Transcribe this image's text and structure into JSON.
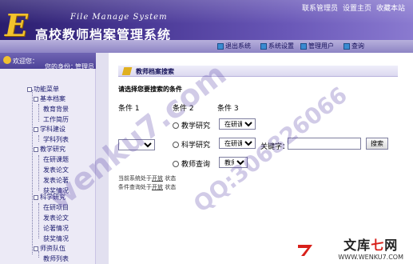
{
  "header": {
    "logo_letter": "E",
    "subtitle_en": "File Manage System",
    "title_cn": "高校教师档案管理系统",
    "links": [
      "联系管理员",
      "设置主页",
      "收藏本站"
    ]
  },
  "toolbar": {
    "items": [
      "退出系统",
      "系统设置",
      "管理用户",
      "查询"
    ]
  },
  "welcome": {
    "greeting": "欢迎您：",
    "role_label": "您的身份：",
    "role_value": "管理员"
  },
  "sidebar": {
    "items": [
      {
        "label": "功能菜单",
        "level": 0
      },
      {
        "label": "基本档案",
        "level": 1
      },
      {
        "label": "教育背景",
        "level": 2
      },
      {
        "label": "工作简历",
        "level": 2
      },
      {
        "label": "学科建设",
        "level": 1
      },
      {
        "label": "学科列表",
        "level": 2
      },
      {
        "label": "教学研究",
        "level": 1
      },
      {
        "label": "在研课题",
        "level": 2
      },
      {
        "label": "发表论文",
        "level": 2
      },
      {
        "label": "发表论著",
        "level": 2
      },
      {
        "label": "获奖情况",
        "level": 2
      },
      {
        "label": "科学研究",
        "level": 1
      },
      {
        "label": "在研项目",
        "level": 2
      },
      {
        "label": "发表论文",
        "level": 2
      },
      {
        "label": "论著情况",
        "level": 2
      },
      {
        "label": "获奖情况",
        "level": 2
      },
      {
        "label": "师资队伍",
        "level": 1
      },
      {
        "label": "教师列表",
        "level": 2
      }
    ]
  },
  "panel": {
    "title": "教师档案搜索",
    "hint": "请选择您要搜索的条件",
    "conditions": [
      "条件 1",
      "条件 2",
      "条件 3"
    ],
    "radios": [
      "教学研究",
      "科学研究",
      "教师查询"
    ],
    "selects": [
      "在研课题",
      "在研课题",
      "教师"
    ],
    "keyword_label": "关键字：",
    "keyword_value": "",
    "search_button": "搜索",
    "status1_pre": "当前系统处于",
    "status1_link": "开放",
    "status1_post": "状态",
    "status2_pre": "条件查询处于",
    "status2_link": "开放",
    "status2_post": "状态"
  },
  "watermarks": [
    "wenku7.com",
    "QQ:306826066"
  ],
  "footer": {
    "brand_a": "文库",
    "brand_b": "七",
    "brand_c": "网",
    "url": "WWW.WENKU7.COM"
  },
  "colors": {
    "header": "#4a3996",
    "accent": "#f2c22c",
    "sidebar_bg": "#eceaf6",
    "brand_red": "#d8201a"
  }
}
